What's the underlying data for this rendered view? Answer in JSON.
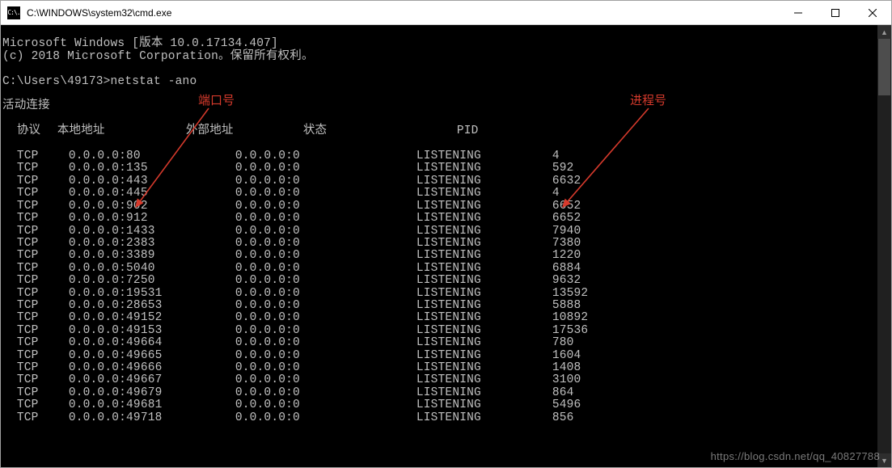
{
  "window": {
    "title": "C:\\WINDOWS\\system32\\cmd.exe",
    "icon_glyph": "C:\\."
  },
  "console": {
    "header1": "Microsoft Windows [版本 10.0.17134.407]",
    "header2": "(c) 2018 Microsoft Corporation。保留所有权利。",
    "prompt": "C:\\Users\\49173>",
    "command": "netstat -ano",
    "section_title": "活动连接",
    "col_proto": "协议",
    "col_local": "本地地址",
    "col_foreign": "外部地址",
    "col_state": "状态",
    "col_pid": "PID",
    "rows": [
      {
        "proto": "TCP",
        "local": "0.0.0.0:80",
        "foreign": "0.0.0.0:0",
        "state": "LISTENING",
        "pid": "4"
      },
      {
        "proto": "TCP",
        "local": "0.0.0.0:135",
        "foreign": "0.0.0.0:0",
        "state": "LISTENING",
        "pid": "592"
      },
      {
        "proto": "TCP",
        "local": "0.0.0.0:443",
        "foreign": "0.0.0.0:0",
        "state": "LISTENING",
        "pid": "6632"
      },
      {
        "proto": "TCP",
        "local": "0.0.0.0:445",
        "foreign": "0.0.0.0:0",
        "state": "LISTENING",
        "pid": "4"
      },
      {
        "proto": "TCP",
        "local": "0.0.0.0:902",
        "foreign": "0.0.0.0:0",
        "state": "LISTENING",
        "pid": "6652"
      },
      {
        "proto": "TCP",
        "local": "0.0.0.0:912",
        "foreign": "0.0.0.0:0",
        "state": "LISTENING",
        "pid": "6652"
      },
      {
        "proto": "TCP",
        "local": "0.0.0.0:1433",
        "foreign": "0.0.0.0:0",
        "state": "LISTENING",
        "pid": "7940"
      },
      {
        "proto": "TCP",
        "local": "0.0.0.0:2383",
        "foreign": "0.0.0.0:0",
        "state": "LISTENING",
        "pid": "7380"
      },
      {
        "proto": "TCP",
        "local": "0.0.0.0:3389",
        "foreign": "0.0.0.0:0",
        "state": "LISTENING",
        "pid": "1220"
      },
      {
        "proto": "TCP",
        "local": "0.0.0.0:5040",
        "foreign": "0.0.0.0:0",
        "state": "LISTENING",
        "pid": "6884"
      },
      {
        "proto": "TCP",
        "local": "0.0.0.0:7250",
        "foreign": "0.0.0.0:0",
        "state": "LISTENING",
        "pid": "9632"
      },
      {
        "proto": "TCP",
        "local": "0.0.0.0:19531",
        "foreign": "0.0.0.0:0",
        "state": "LISTENING",
        "pid": "13592"
      },
      {
        "proto": "TCP",
        "local": "0.0.0.0:28653",
        "foreign": "0.0.0.0:0",
        "state": "LISTENING",
        "pid": "5888"
      },
      {
        "proto": "TCP",
        "local": "0.0.0.0:49152",
        "foreign": "0.0.0.0:0",
        "state": "LISTENING",
        "pid": "10892"
      },
      {
        "proto": "TCP",
        "local": "0.0.0.0:49153",
        "foreign": "0.0.0.0:0",
        "state": "LISTENING",
        "pid": "17536"
      },
      {
        "proto": "TCP",
        "local": "0.0.0.0:49664",
        "foreign": "0.0.0.0:0",
        "state": "LISTENING",
        "pid": "780"
      },
      {
        "proto": "TCP",
        "local": "0.0.0.0:49665",
        "foreign": "0.0.0.0:0",
        "state": "LISTENING",
        "pid": "1604"
      },
      {
        "proto": "TCP",
        "local": "0.0.0.0:49666",
        "foreign": "0.0.0.0:0",
        "state": "LISTENING",
        "pid": "1408"
      },
      {
        "proto": "TCP",
        "local": "0.0.0.0:49667",
        "foreign": "0.0.0.0:0",
        "state": "LISTENING",
        "pid": "3100"
      },
      {
        "proto": "TCP",
        "local": "0.0.0.0:49679",
        "foreign": "0.0.0.0:0",
        "state": "LISTENING",
        "pid": "864"
      },
      {
        "proto": "TCP",
        "local": "0.0.0.0:49681",
        "foreign": "0.0.0.0:0",
        "state": "LISTENING",
        "pid": "5496"
      },
      {
        "proto": "TCP",
        "local": "0.0.0.0:49718",
        "foreign": "0.0.0.0:0",
        "state": "LISTENING",
        "pid": "856"
      }
    ]
  },
  "annotations": {
    "port_label": "端口号",
    "pid_label": "进程号"
  },
  "watermark": "https://blog.csdn.net/qq_40827788"
}
